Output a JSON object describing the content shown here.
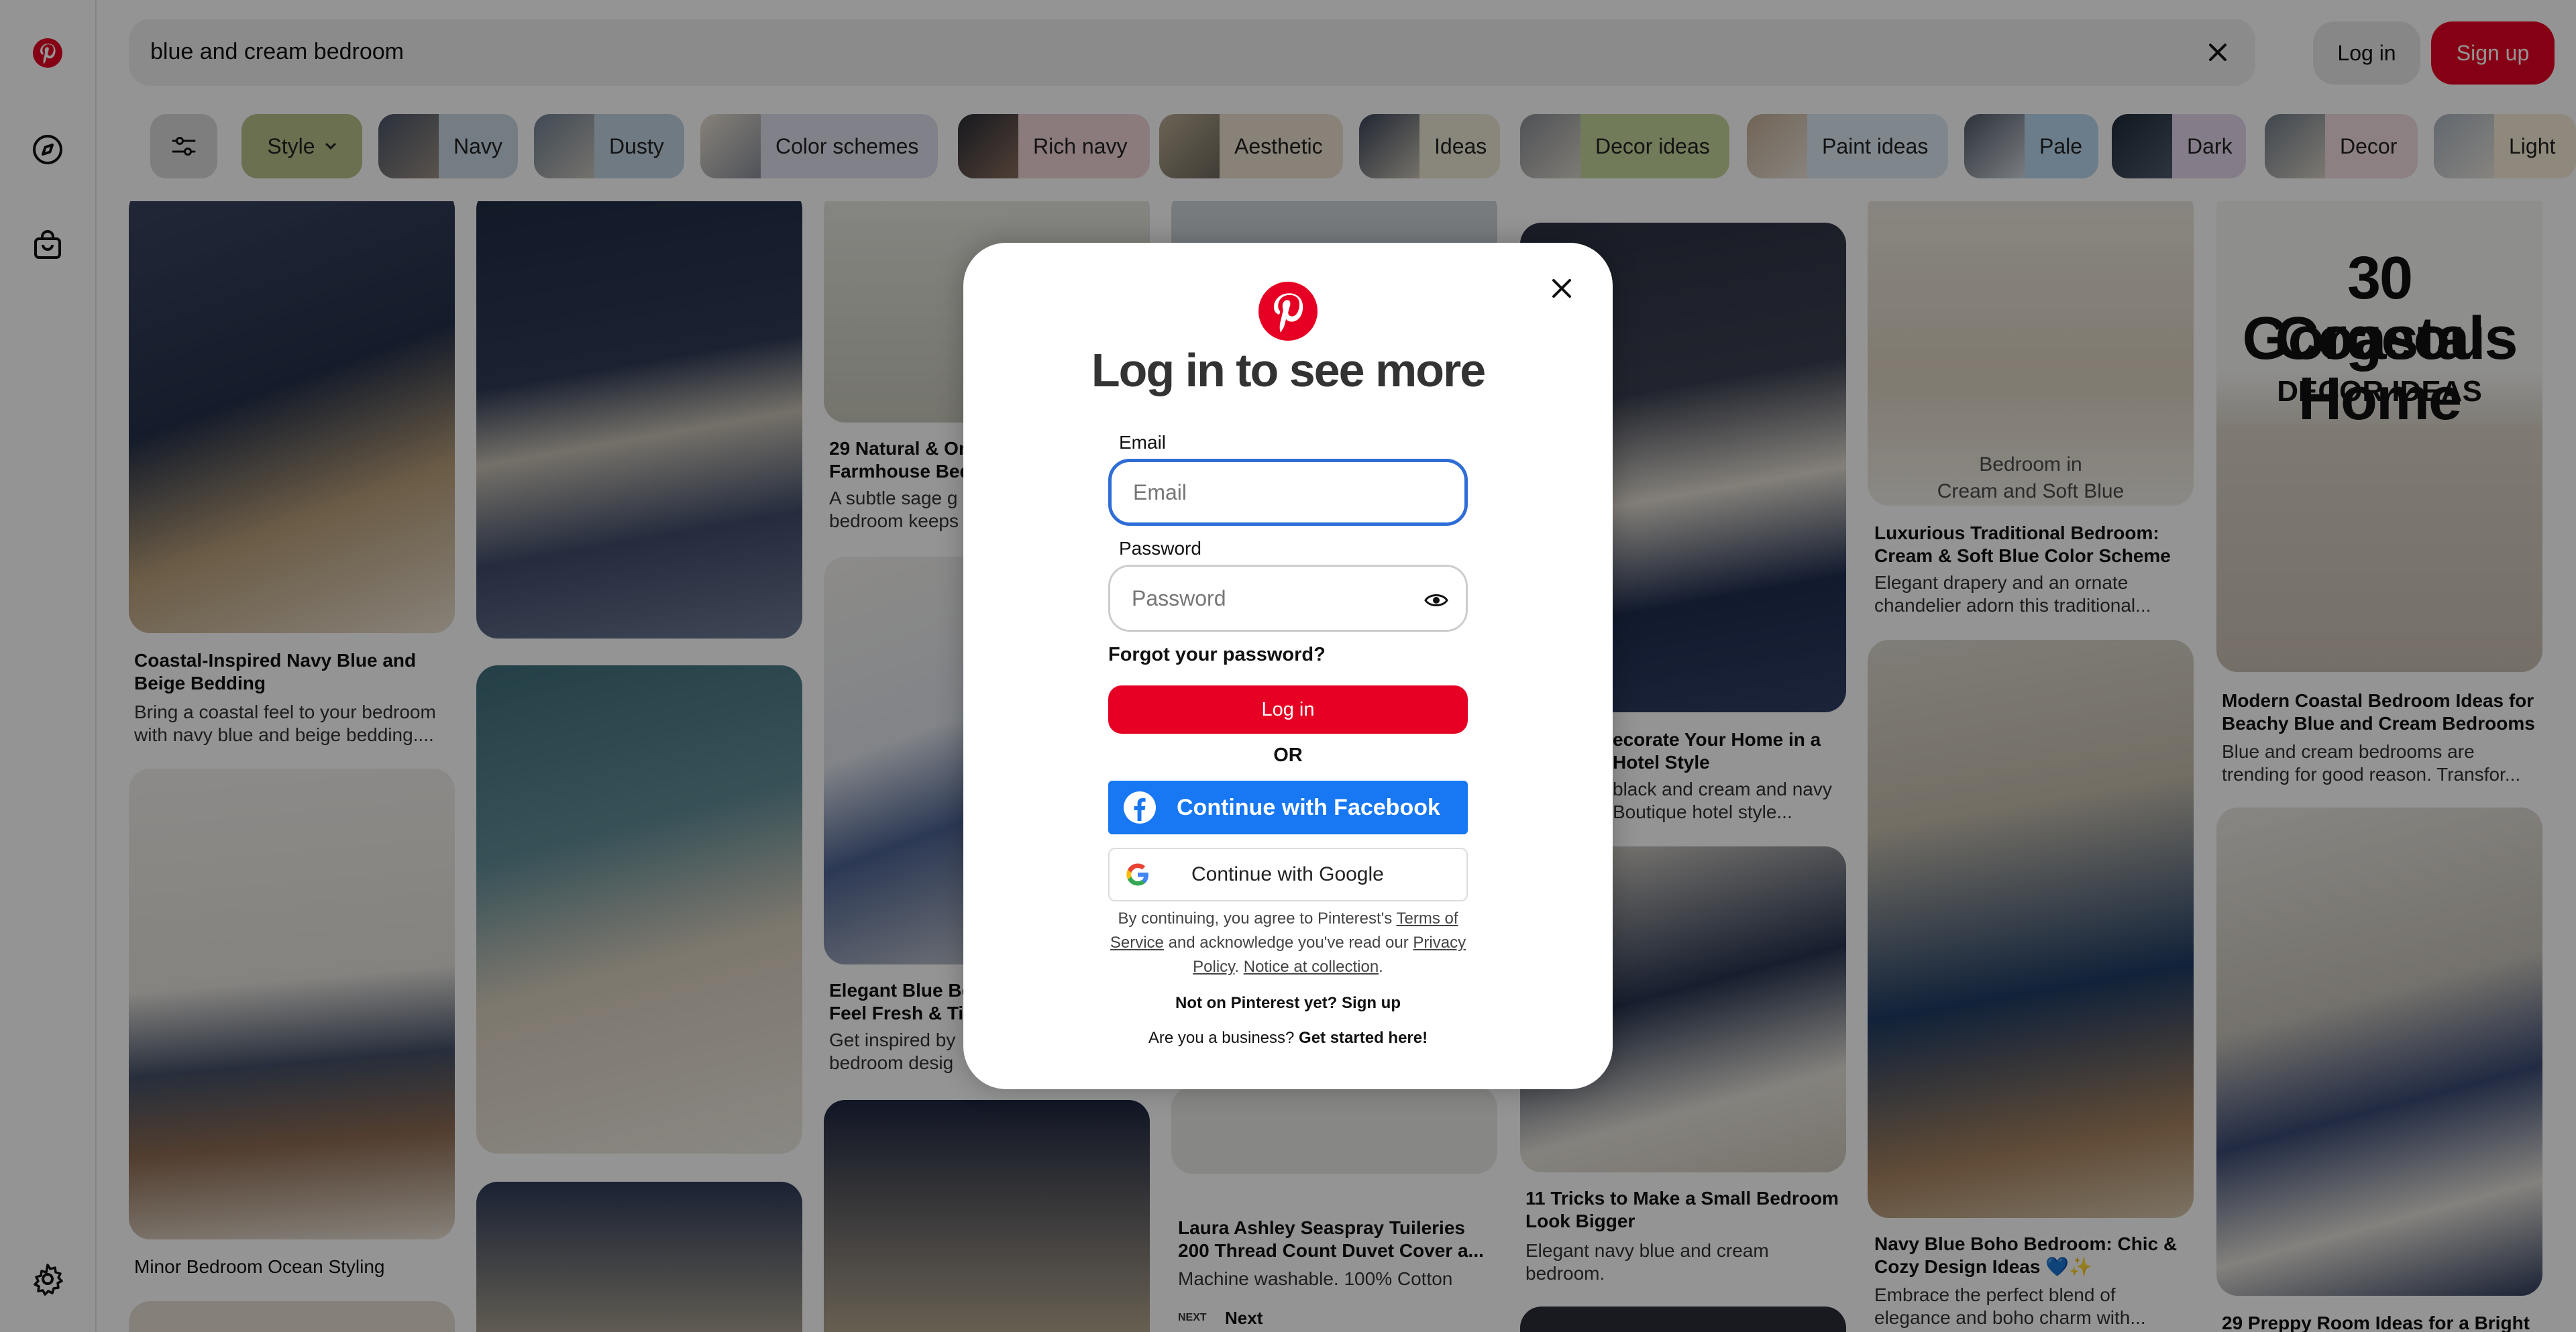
{
  "brand": {
    "color": "#e60023",
    "logo_icon": "pinterest-logo-icon"
  },
  "rail": {
    "items": [
      {
        "name": "pinterest-logo-icon"
      },
      {
        "name": "explore-compass-icon"
      },
      {
        "name": "shop-bag-icon"
      }
    ],
    "settings_icon": "gear-icon"
  },
  "search": {
    "query": "blue and cream bedroom"
  },
  "header": {
    "login_label": "Log in",
    "signup_label": "Sign up"
  },
  "chips": {
    "style_label": "Style",
    "items": [
      {
        "label": "Navy",
        "color": "#c9d7e4"
      },
      {
        "label": "Dusty",
        "color": "#c2d2e2"
      },
      {
        "label": "Color schemes",
        "color": "#dfdfee"
      },
      {
        "label": "Rich navy",
        "color": "#efd5d6"
      },
      {
        "label": "Aesthetic",
        "color": "#ece0cf"
      },
      {
        "label": "Ideas",
        "color": "#ece9d5"
      },
      {
        "label": "Decor ideas",
        "color": "#c5d49a"
      },
      {
        "label": "Paint ideas",
        "color": "#dbe8f3"
      },
      {
        "label": "Pale",
        "color": "#b8d7f0"
      },
      {
        "label": "Dark",
        "color": "#e4d8ec"
      },
      {
        "label": "Decor",
        "color": "#f1dde0"
      },
      {
        "label": "Light",
        "color": "#f6ead7"
      }
    ]
  },
  "pins": [
    {
      "title": "Coastal-Inspired Navy Blue and Beige Bedding",
      "desc": "Bring a coastal feel to your bedroom with navy blue and beige bedding...."
    },
    {
      "title": "Minor Bedroom Ocean Styling",
      "desc": ""
    },
    {
      "title": "29 Natural & Or Farmhouse Bed",
      "desc": "A subtle sage g bedroom keeps"
    },
    {
      "title": "Elegant Blue Be Feel Fresh & Ti",
      "desc": "Get inspired by bedroom desig"
    },
    {
      "title": "Laura Ashley Seaspray Tuileries 200 Thread Count Duvet Cover a...",
      "desc": "Machine washable. 100% Cotton"
    },
    {
      "title": "ecorate Your Home in a Hotel Style",
      "desc": "black and cream and navy Boutique hotel style..."
    },
    {
      "title": "11 Tricks to Make a Small Bedroom Look Bigger",
      "desc": "Elegant navy blue and cream bedroom."
    },
    {
      "title": "Luxurious Traditional Bedroom: Cream & Soft Blue Color Scheme",
      "desc": "Elegant drapery and an ornate chandelier adorn this traditional..."
    },
    {
      "title": "Navy Blue Boho Bedroom: Chic & Cozy Design Ideas 💙✨",
      "desc": "Embrace the perfect blend of elegance and boho charm with..."
    },
    {
      "title": "Modern Coastal Bedroom Ideas for Beachy Blue and Cream Bedrooms",
      "desc": "Blue and cream bedrooms are trending for good reason. Transfor..."
    },
    {
      "title": "29 Preppy Room Ideas for a Bright",
      "desc": ""
    }
  ],
  "pin_overlays": {
    "bedroom_caption_1": "Bedroom in",
    "bedroom_caption_2": "Cream and Soft Blue",
    "coastal_1": "30 Gorgeous",
    "coastal_2": "Coastal Home",
    "coastal_3": "DECOR IDEAS",
    "next_small": "NEXT",
    "next_label": "Next"
  },
  "modal": {
    "title": "Log in to see more",
    "email_label": "Email",
    "email_placeholder": "Email",
    "password_label": "Password",
    "password_placeholder": "Password",
    "forgot": "Forgot your password?",
    "login_button": "Log in",
    "or": "OR",
    "facebook_button": "Continue with Facebook",
    "google_button": "Continue with Google",
    "legal_prefix": "By continuing, you agree to Pinterest's",
    "terms": "Terms of Service",
    "legal_middle": "and acknowledge you've read our",
    "privacy": "Privacy Policy",
    "notice": "Notice at collection",
    "not_on": "Not on Pinterest yet? Sign up",
    "business_prefix": "Are you a business?",
    "business_link": "Get started here!"
  }
}
